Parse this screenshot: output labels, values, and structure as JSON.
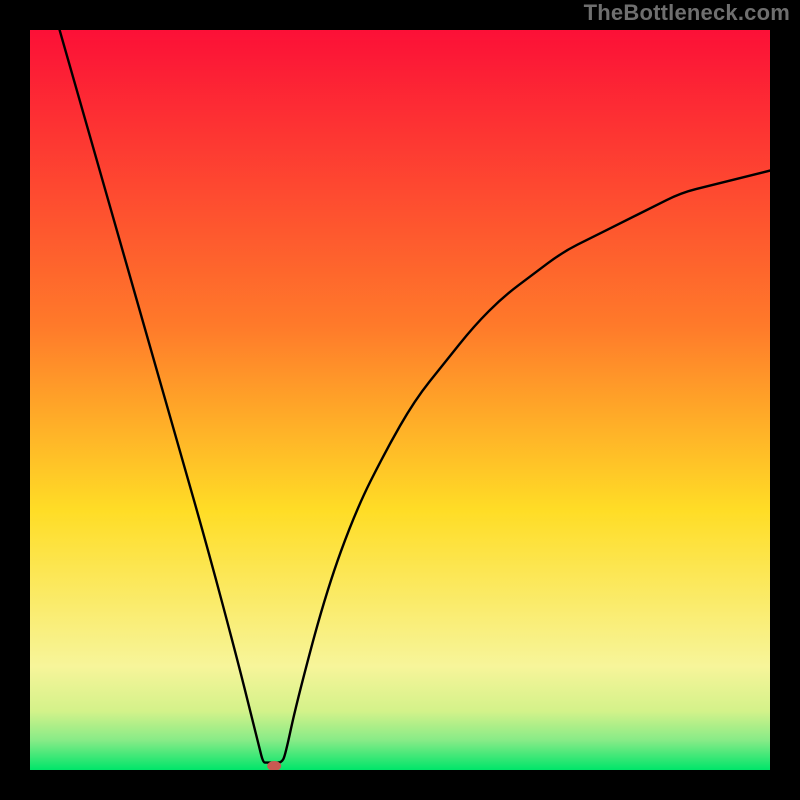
{
  "watermark": "TheBottleneck.com",
  "chart_data": {
    "type": "line",
    "title": "",
    "xlabel": "",
    "ylabel": "",
    "xlim": [
      0,
      100
    ],
    "ylim": [
      0,
      100
    ],
    "grid": false,
    "legend": false,
    "colors": {
      "gradient_top": "#fc1037",
      "gradient_mid": "#ffdd26",
      "gradient_bottom": "#00e56a",
      "curve": "#000000",
      "marker": "#c85a52",
      "frame": "#000000"
    },
    "marker": {
      "x": 33,
      "y": 0
    },
    "series": [
      {
        "name": "bottleneck-curve",
        "points": [
          {
            "x": 4,
            "y": 100
          },
          {
            "x": 8,
            "y": 86
          },
          {
            "x": 12,
            "y": 72
          },
          {
            "x": 16,
            "y": 58
          },
          {
            "x": 20,
            "y": 44
          },
          {
            "x": 24,
            "y": 30
          },
          {
            "x": 28,
            "y": 15
          },
          {
            "x": 30,
            "y": 7
          },
          {
            "x": 31,
            "y": 3
          },
          {
            "x": 31.5,
            "y": 1
          },
          {
            "x": 32,
            "y": 1
          },
          {
            "x": 33,
            "y": 1
          },
          {
            "x": 34,
            "y": 1
          },
          {
            "x": 34.5,
            "y": 2
          },
          {
            "x": 36,
            "y": 9
          },
          {
            "x": 40,
            "y": 24
          },
          {
            "x": 44,
            "y": 35
          },
          {
            "x": 48,
            "y": 43
          },
          {
            "x": 52,
            "y": 50
          },
          {
            "x": 56,
            "y": 55
          },
          {
            "x": 60,
            "y": 60
          },
          {
            "x": 64,
            "y": 64
          },
          {
            "x": 68,
            "y": 67
          },
          {
            "x": 72,
            "y": 70
          },
          {
            "x": 76,
            "y": 72
          },
          {
            "x": 80,
            "y": 74
          },
          {
            "x": 84,
            "y": 76
          },
          {
            "x": 88,
            "y": 78
          },
          {
            "x": 92,
            "y": 79
          },
          {
            "x": 96,
            "y": 80
          },
          {
            "x": 100,
            "y": 81
          }
        ]
      }
    ]
  }
}
